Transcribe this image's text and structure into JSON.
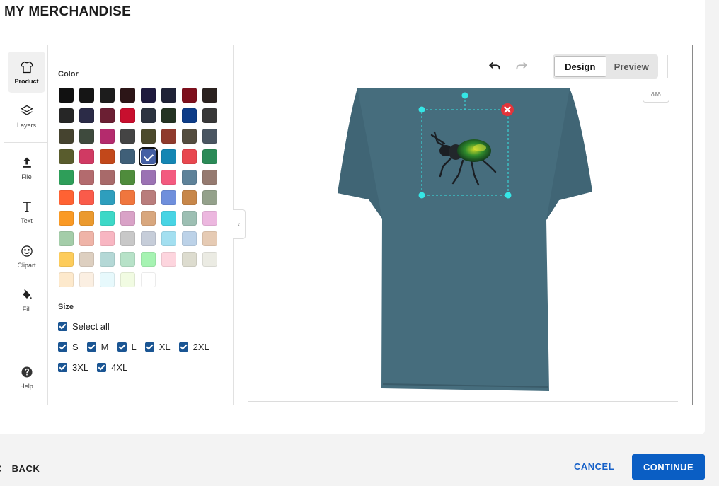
{
  "page": {
    "title": "MY MERCHANDISE"
  },
  "tools": [
    {
      "id": "product",
      "label": "Product",
      "active": true
    },
    {
      "id": "layers",
      "label": "Layers"
    },
    {
      "id": "file",
      "label": "File"
    },
    {
      "id": "text",
      "label": "Text"
    },
    {
      "id": "clipart",
      "label": "Clipart"
    },
    {
      "id": "fill",
      "label": "Fill"
    },
    {
      "id": "help",
      "label": "Help"
    }
  ],
  "color": {
    "label": "Color",
    "selected_index": 28,
    "swatches": [
      "#111111",
      "#151515",
      "#1c1c1c",
      "#2c1517",
      "#1e1a3d",
      "#1f2236",
      "#7d0f1c",
      "#2b2220",
      "#262626",
      "#2b2b47",
      "#6b1f33",
      "#c80f2e",
      "#2c3340",
      "#243322",
      "#0d3c87",
      "#383838",
      "#45432f",
      "#3e4a3d",
      "#b42b6d",
      "#444444",
      "#4c4a2c",
      "#8f3a2c",
      "#544d3f",
      "#4a5561",
      "#595c2d",
      "#d03a63",
      "#c2481a",
      "#3f5f78",
      "#4560a4",
      "#1486b3",
      "#e8474f",
      "#2b8a57",
      "#2e9e59",
      "#b36b6e",
      "#a86a6a",
      "#4f8c3c",
      "#9b72b3",
      "#f35a7f",
      "#5e8299",
      "#957a70",
      "#ff6233",
      "#fa5b4a",
      "#2e9ebd",
      "#f0763e",
      "#b97d7c",
      "#6f8fdc",
      "#c7874a",
      "#94a18b",
      "#fa9a25",
      "#eb9a2e",
      "#3dd8c7",
      "#d9a2c7",
      "#d8a77e",
      "#48d4e4",
      "#9dbfb3",
      "#ecb7df",
      "#a4cda9",
      "#efb4a8",
      "#f8b6c2",
      "#c8c8c8",
      "#c6cdd9",
      "#a3dff0",
      "#bcd2e8",
      "#e6cbb4",
      "#fdcc5b",
      "#ddcfc0",
      "#b4d8d6",
      "#b7e2c8",
      "#a6f3b2",
      "#fdd5de",
      "#dddccf",
      "#ebebe3",
      "#fde9cc",
      "#fbefe2",
      "#e7f9fc",
      "#f1fbe2",
      "#ffffff"
    ]
  },
  "size": {
    "label": "Size",
    "select_all_label": "Select all",
    "options": [
      "S",
      "M",
      "L",
      "XL",
      "2XL",
      "3XL",
      "4XL"
    ]
  },
  "toolbar": {
    "undo": "undo-icon",
    "redo": "redo-icon",
    "design_label": "Design",
    "preview_label": "Preview",
    "active_mode": "Design"
  },
  "product": {
    "shirt_color": "#466d7d",
    "artwork": "green beetle"
  },
  "footer": {
    "back_label": "BACK",
    "cancel_label": "CANCEL",
    "continue_label": "CONTINUE"
  },
  "colors": {
    "accent": "#0a5ec4",
    "checkbox": "#1a5593",
    "handle": "#35e6e6",
    "delete": "#e3343a"
  }
}
